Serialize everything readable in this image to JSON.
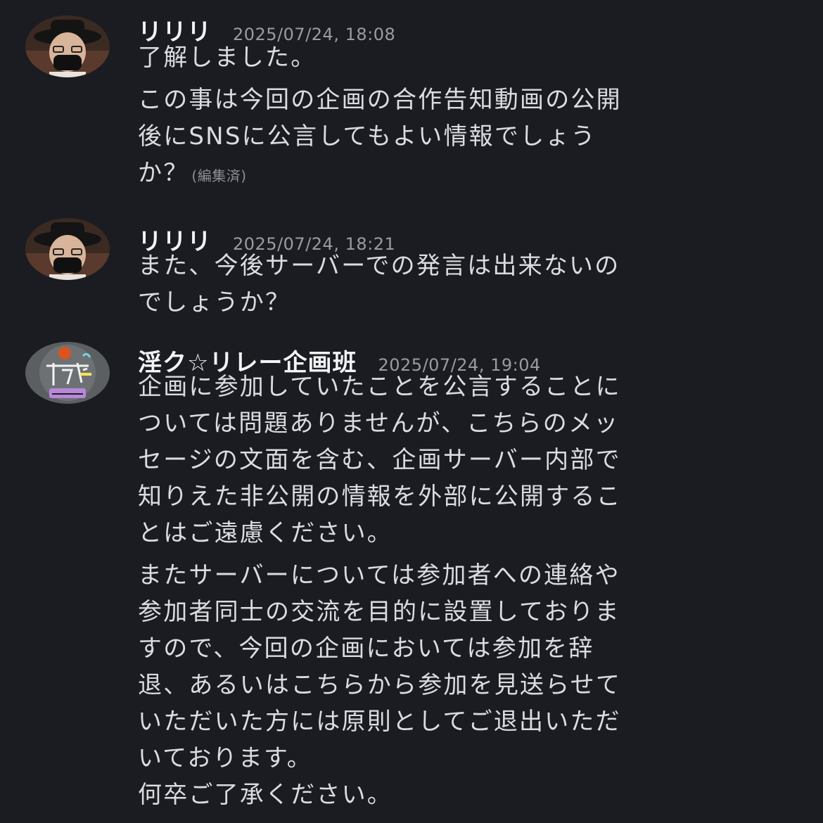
{
  "messages": [
    {
      "author": "リリリ",
      "timestamp": "2025/07/24, 18:08",
      "avatar_icon": "user-avatar-hat-mask",
      "paragraphs": [
        [
          "了解しました。"
        ],
        [
          "この事は今回の企画の合作告知動画の公開",
          "後にSNSに公言してもよい情報でしょう",
          "か？"
        ]
      ],
      "edited_label": "(編集済)"
    },
    {
      "author": "リリリ",
      "timestamp": "2025/07/24, 18:21",
      "avatar_icon": "user-avatar-hat-mask",
      "paragraphs": [
        [
          "また、今後サーバーでの発言は出来ないの",
          "でしょうか？"
        ]
      ]
    },
    {
      "author": "淫ク☆リレー企画班",
      "timestamp": "2025/07/24, 19:04",
      "avatar_icon": "group-avatar-logo",
      "paragraphs": [
        [
          "企画に参加していたことを公言することに",
          "ついては問題ありませんが、こちらのメッ",
          "セージの文面を含む、企画サーバー内部で",
          "知りえた非公開の情報を外部に公開するこ",
          "とはご遠慮ください。"
        ],
        [
          "またサーバーについては参加者への連絡や",
          "参加者同士の交流を目的に設置しておりま",
          "すので、今回の企画においては参加を辞",
          "退、あるいはこちらから参加を見送らせて",
          "いただいた方には原則としてご退出いただ",
          "いております。",
          "何卒ご了承ください。"
        ]
      ]
    }
  ],
  "colors": {
    "background": "#1b1c21",
    "username": "#f2f3f5",
    "message_text": "#dbdce0",
    "timestamp": "#9a9ba3",
    "edited": "#8e8f96"
  }
}
